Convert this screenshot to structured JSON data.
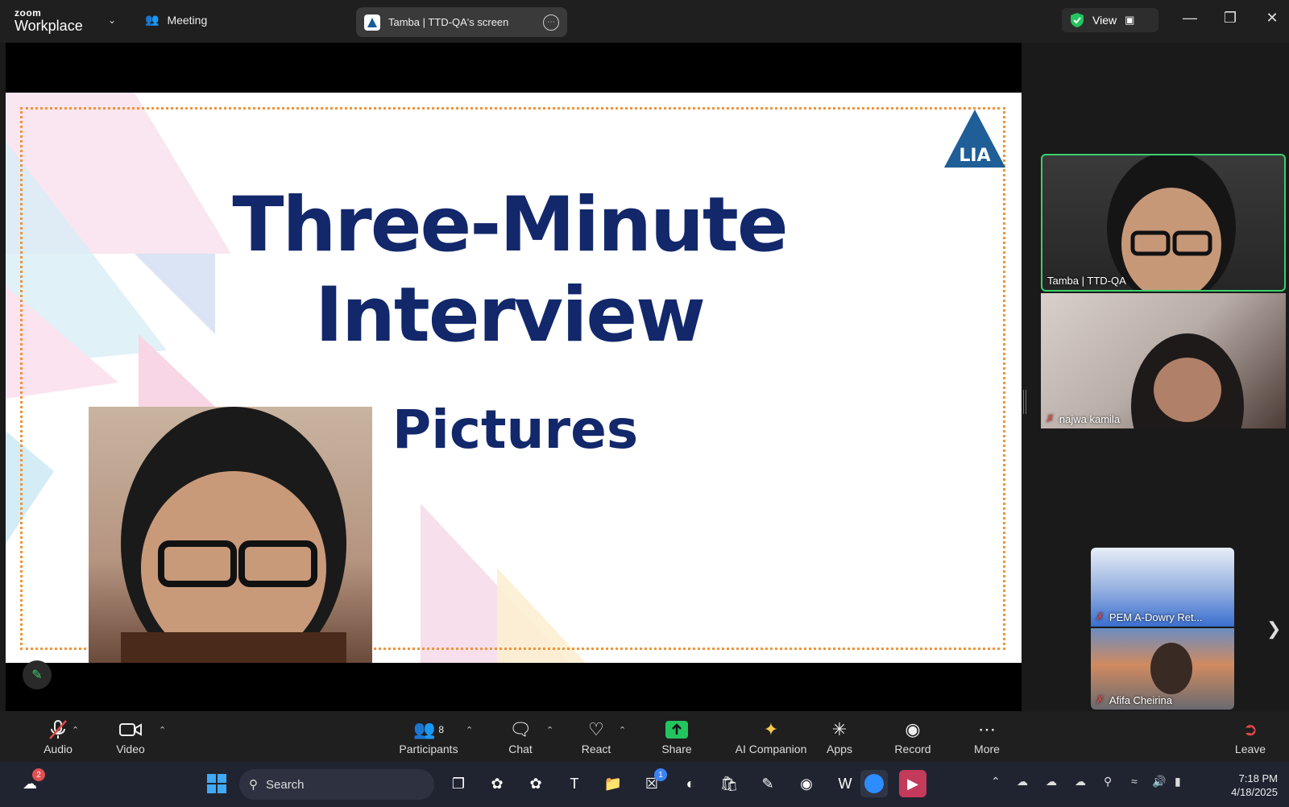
{
  "window": {
    "brand_top": "zoom",
    "brand_bottom": "Workplace",
    "meeting_label": "Meeting",
    "screen_share_title": "Tamba | TTD-QA's screen",
    "view_label": "View"
  },
  "slide": {
    "title_line1": "Three-Minute",
    "title_line2": "Interview",
    "subtitle": "Pictures",
    "logo_text": "LIA"
  },
  "participants": [
    {
      "name": "Tamba | TTD-QA",
      "muted": false,
      "active_speaker": true
    },
    {
      "name": "najwa kamila",
      "muted": true
    },
    {
      "name": "PEM A-Dowry Ret...",
      "muted": true
    },
    {
      "name": "Afifa Cheirina",
      "muted": true
    }
  ],
  "toolbar": {
    "audio": "Audio",
    "video": "Video",
    "participants": "Participants",
    "participants_count": "8",
    "chat": "Chat",
    "react": "React",
    "share": "Share",
    "ai_companion": "AI Companion",
    "apps": "Apps",
    "record": "Record",
    "more": "More",
    "leave": "Leave"
  },
  "taskbar": {
    "search_placeholder": "Search",
    "weather_badge": "2",
    "xbox_badge": "1",
    "time": "7:18 PM",
    "date": "4/18/2025"
  },
  "colors": {
    "slide_title": "#12286b",
    "frame": "#f0943a",
    "active_speaker_border": "#3ad06c",
    "share_green": "#22c55e"
  }
}
